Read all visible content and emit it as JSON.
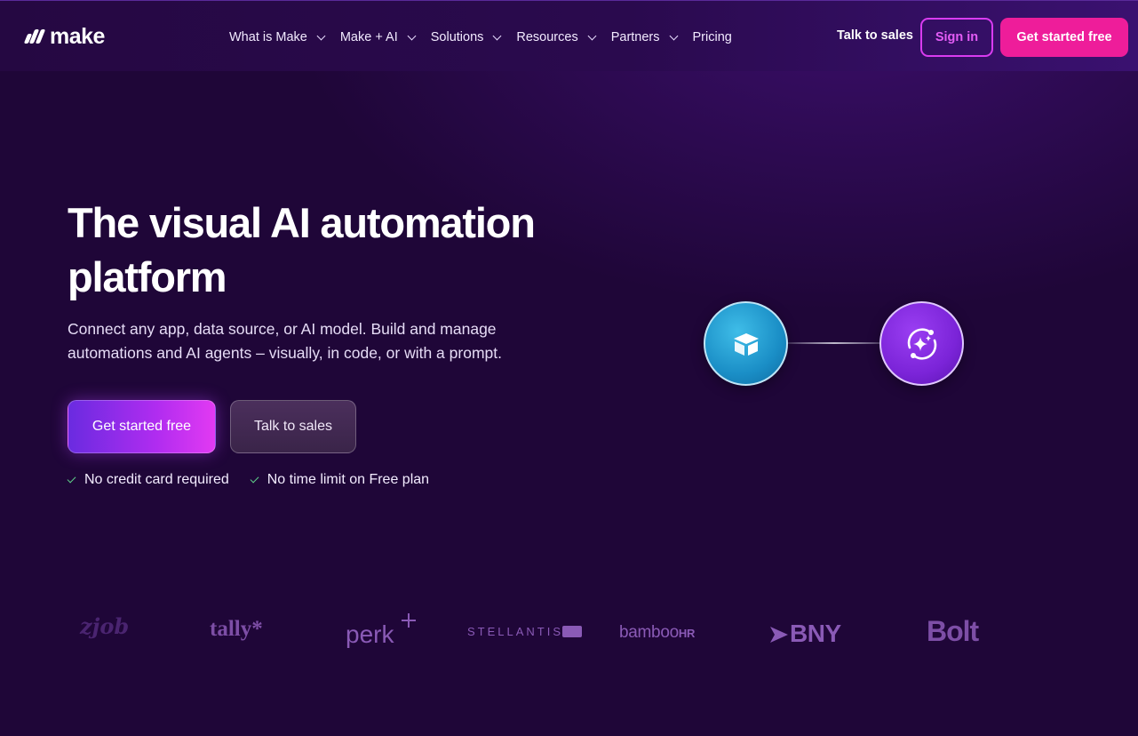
{
  "brand": {
    "name": "make"
  },
  "nav": {
    "items": [
      {
        "label": "What is Make",
        "has_dropdown": true
      },
      {
        "label": "Make + AI",
        "has_dropdown": true
      },
      {
        "label": "Solutions",
        "has_dropdown": true
      },
      {
        "label": "Resources",
        "has_dropdown": true
      },
      {
        "label": "Partners",
        "has_dropdown": true
      },
      {
        "label": "Pricing",
        "has_dropdown": false
      }
    ],
    "talk_to_sales": "Talk to sales",
    "sign_in": "Sign in",
    "get_started": "Get started free"
  },
  "hero": {
    "title": "The visual AI automation platform",
    "subtitle": "Connect any app, data source, or AI model. Build and manage automations and AI agents – visually, in code, or with a prompt.",
    "primary_cta": "Get started free",
    "secondary_cta": "Talk to sales",
    "perks": [
      "No credit card required",
      "No time limit on Free plan"
    ]
  },
  "visual": {
    "left_node_icon": "box-icon",
    "right_node_icon": "ai-sparkle-icon",
    "colors": {
      "left_node": "#1a8ec6",
      "right_node": "#7b24d8"
    }
  },
  "logos": {
    "zjob": "zjob",
    "tally": "tally*",
    "perk": "perk",
    "stellantis": "STELLANTIS",
    "bamboo_main": "bamboo",
    "bamboo_suffix": "HR",
    "bny": "BNY",
    "bolt": "Bolt"
  },
  "colors": {
    "background": "#1f0638",
    "accent_pink": "#ee1d9a",
    "accent_magenta": "#d93cf0",
    "check_green": "#5fd08a"
  }
}
